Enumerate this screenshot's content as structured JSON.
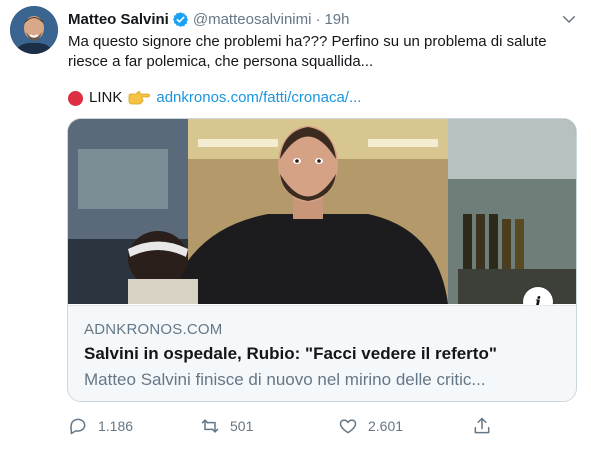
{
  "tweet": {
    "name": "Matteo Salvini",
    "handle": "@matteosalvinimi",
    "separator": "·",
    "time": "19h",
    "text_line1": "Ma questo signore che problemi ha??? Perfino su un problema di salute",
    "text_line2": "riesce a far polemica, che persona squallida...",
    "link_label": "LINK",
    "link_url": "adnkronos.com/fatti/cronaca/..."
  },
  "card": {
    "domain": "ADNKRONOS.COM",
    "title": "Salvini in ospedale, Rubio: \"Facci vedere il referto\"",
    "description": "Matteo Salvini finisce di nuovo nel mirino delle critic...",
    "info_badge": "i"
  },
  "actions": {
    "replies": "1.186",
    "retweets": "501",
    "likes": "2.601"
  },
  "colors": {
    "link": "#1b95e0",
    "muted": "#657786",
    "red_dot": "#dd2e44"
  },
  "icons": [
    "verified-badge-icon",
    "chevron-down-icon",
    "red-circle-icon",
    "pointing-hand-icon",
    "info-icon",
    "reply-icon",
    "retweet-icon",
    "like-icon",
    "share-icon"
  ]
}
